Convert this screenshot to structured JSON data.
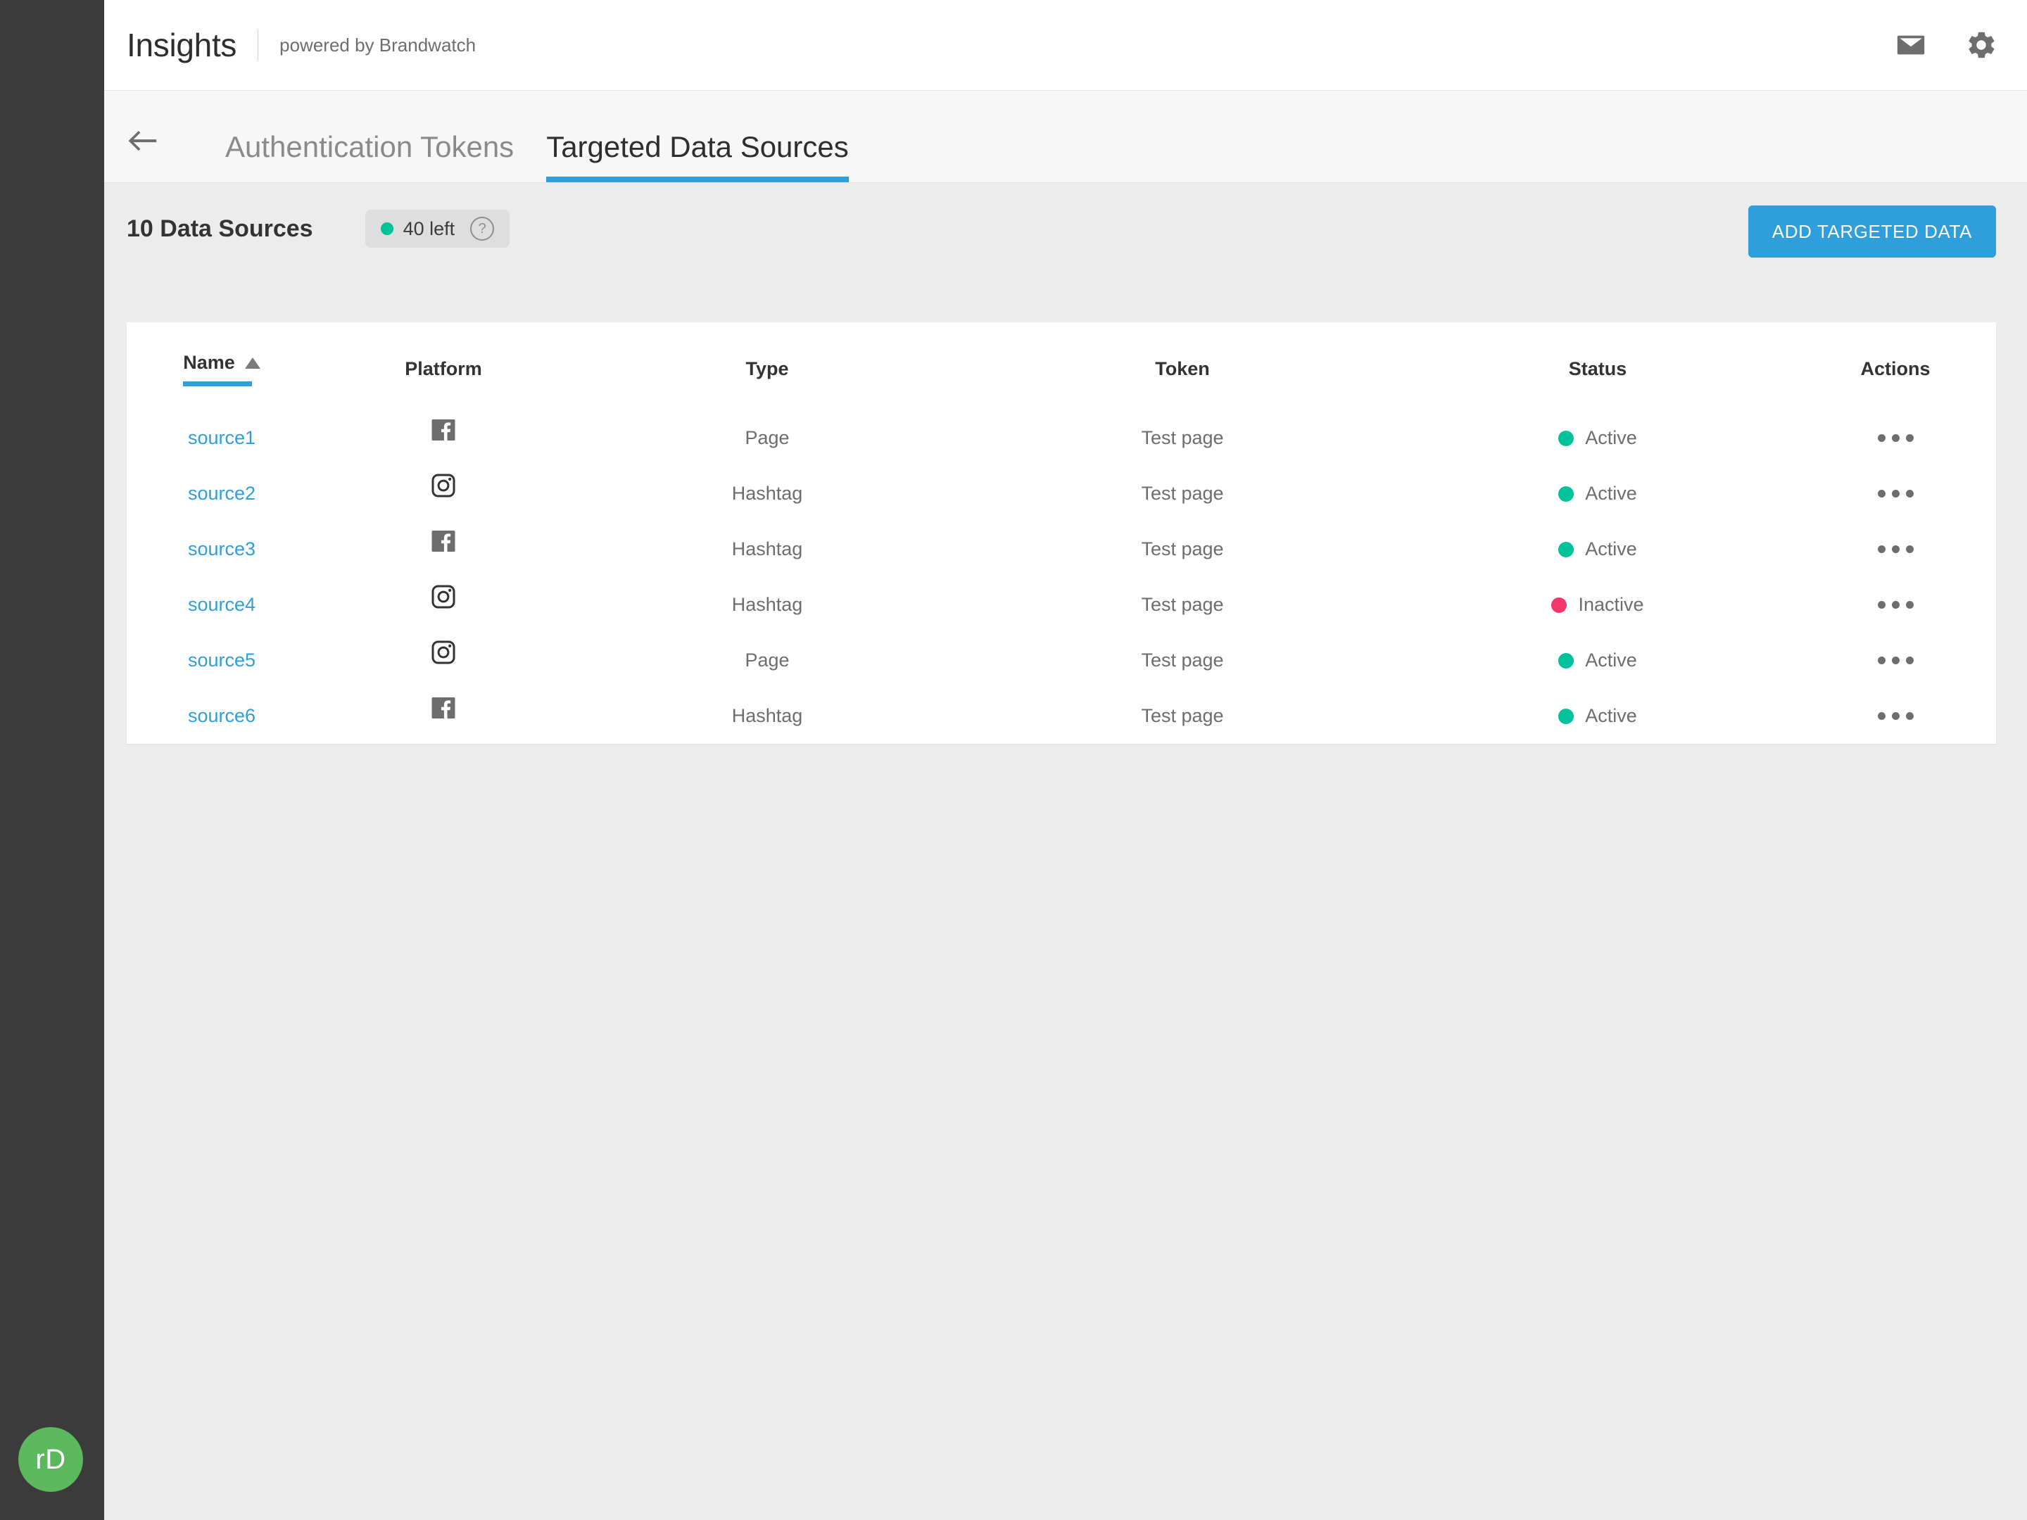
{
  "brand": {
    "title": "Insights",
    "subtitle": "powered by Brandwatch"
  },
  "header": {
    "mail_icon": "mail-icon",
    "settings_icon": "gear-icon"
  },
  "tabs": {
    "back_icon": "arrow-left-icon",
    "items": [
      {
        "label": "Authentication Tokens",
        "active": false
      },
      {
        "label": "Targeted Data Sources",
        "active": true
      }
    ]
  },
  "subheader": {
    "count_title": "10 Data Sources",
    "quota_label": "40 left",
    "quota_dot_color": "#00c29a",
    "help_icon": "help-circle-icon",
    "help_glyph": "?",
    "add_button_label": "ADD TARGETED DATA",
    "add_button_color": "#2e9fda"
  },
  "table": {
    "columns": [
      {
        "key": "name",
        "label": "Name",
        "sorted": "asc"
      },
      {
        "key": "platform",
        "label": "Platform"
      },
      {
        "key": "type",
        "label": "Type"
      },
      {
        "key": "token",
        "label": "Token"
      },
      {
        "key": "status",
        "label": "Status"
      },
      {
        "key": "actions",
        "label": "Actions"
      }
    ],
    "rows": [
      {
        "name": "source1",
        "platform": "facebook-icon",
        "type": "Page",
        "token": "Test page",
        "status": "Active",
        "status_state": "active",
        "actions": "more-options-icon"
      },
      {
        "name": "source2",
        "platform": "instagram-icon",
        "type": "Hashtag",
        "token": "Test page",
        "status": "Active",
        "status_state": "active",
        "actions": "more-options-icon"
      },
      {
        "name": "source3",
        "platform": "facebook-icon",
        "type": "Hashtag",
        "token": "Test page",
        "status": "Active",
        "status_state": "active",
        "actions": "more-options-icon"
      },
      {
        "name": "source4",
        "platform": "instagram-icon",
        "type": "Hashtag",
        "token": "Test page",
        "status": "Inactive",
        "status_state": "inactive",
        "actions": "more-options-icon"
      },
      {
        "name": "source5",
        "platform": "instagram-icon",
        "type": "Page",
        "token": "Test page",
        "status": "Active",
        "status_state": "active",
        "actions": "more-options-icon"
      },
      {
        "name": "source6",
        "platform": "facebook-icon",
        "type": "Hashtag",
        "token": "Test page",
        "status": "Active",
        "status_state": "active",
        "actions": "more-options-icon"
      }
    ]
  },
  "sidebar": {
    "avatar_initials": "rD",
    "avatar_color": "#5cb85c"
  }
}
